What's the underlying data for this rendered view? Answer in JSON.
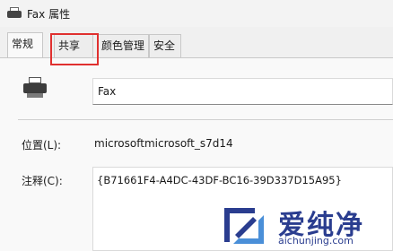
{
  "window": {
    "title": "Fax 属性"
  },
  "tabs": [
    {
      "label": "常规",
      "active": true
    },
    {
      "label": "共享",
      "active": false,
      "highlighted": true
    },
    {
      "label": "颜色管理",
      "active": false
    },
    {
      "label": "安全",
      "active": false
    }
  ],
  "general": {
    "printer_name": "Fax",
    "location_label": "位置(L):",
    "location_value": "microsoftmicrosoft_s7d14",
    "comment_label": "注释(C):",
    "comment_value": "{B71661F4-A4DC-43DF-BC16-39D337D15A95}"
  },
  "watermark": {
    "text": "爱纯净",
    "url": "aichunjing.com"
  },
  "colors": {
    "highlight": "#e0302f",
    "watermark": "#2a3d8f"
  }
}
